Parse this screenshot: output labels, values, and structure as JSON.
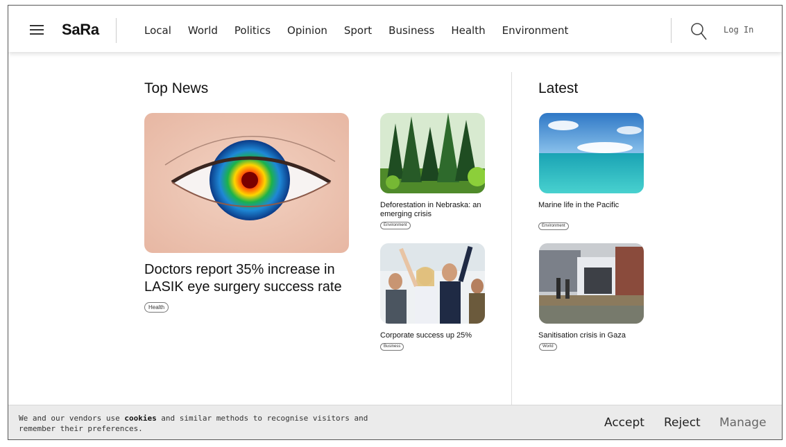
{
  "header": {
    "logo": "SaRa",
    "nav": [
      "Local",
      "World",
      "Politics",
      "Opinion",
      "Sport",
      "Business",
      "Health",
      "Environment"
    ],
    "login_label": "Log In"
  },
  "top_news": {
    "title": "Top News",
    "feature": {
      "headline": "Doctors report 35% increase in LASIK eye surgery success rate",
      "tag": "Health",
      "image": "eye-closeup-image"
    },
    "side_stories": [
      {
        "headline": "Deforestation in Nebraska: an emerging crisis",
        "tag": "Environment",
        "image": "forest-image"
      },
      {
        "headline": "Corporate success up 25%",
        "tag": "Business",
        "image": "celebrating-team-image"
      }
    ]
  },
  "latest": {
    "title": "Latest",
    "stories": [
      {
        "headline": "Marine life in the Pacific",
        "tag": "Environment",
        "image": "ocean-image"
      },
      {
        "headline": "Sanitisation crisis in Gaza",
        "tag": "World",
        "image": "refugee-camp-image"
      }
    ]
  },
  "cookie_bar": {
    "text_before": "We and our vendors use ",
    "text_bold": "cookies",
    "text_after": " and similar methods to recognise visitors and remember their preferences.",
    "accept_label": "Accept",
    "reject_label": "Reject",
    "manage_label": "Manage"
  },
  "colors": {
    "accent_text": "#111111",
    "cookie_bg": "#ebebeb",
    "manage_text": "#666666"
  }
}
